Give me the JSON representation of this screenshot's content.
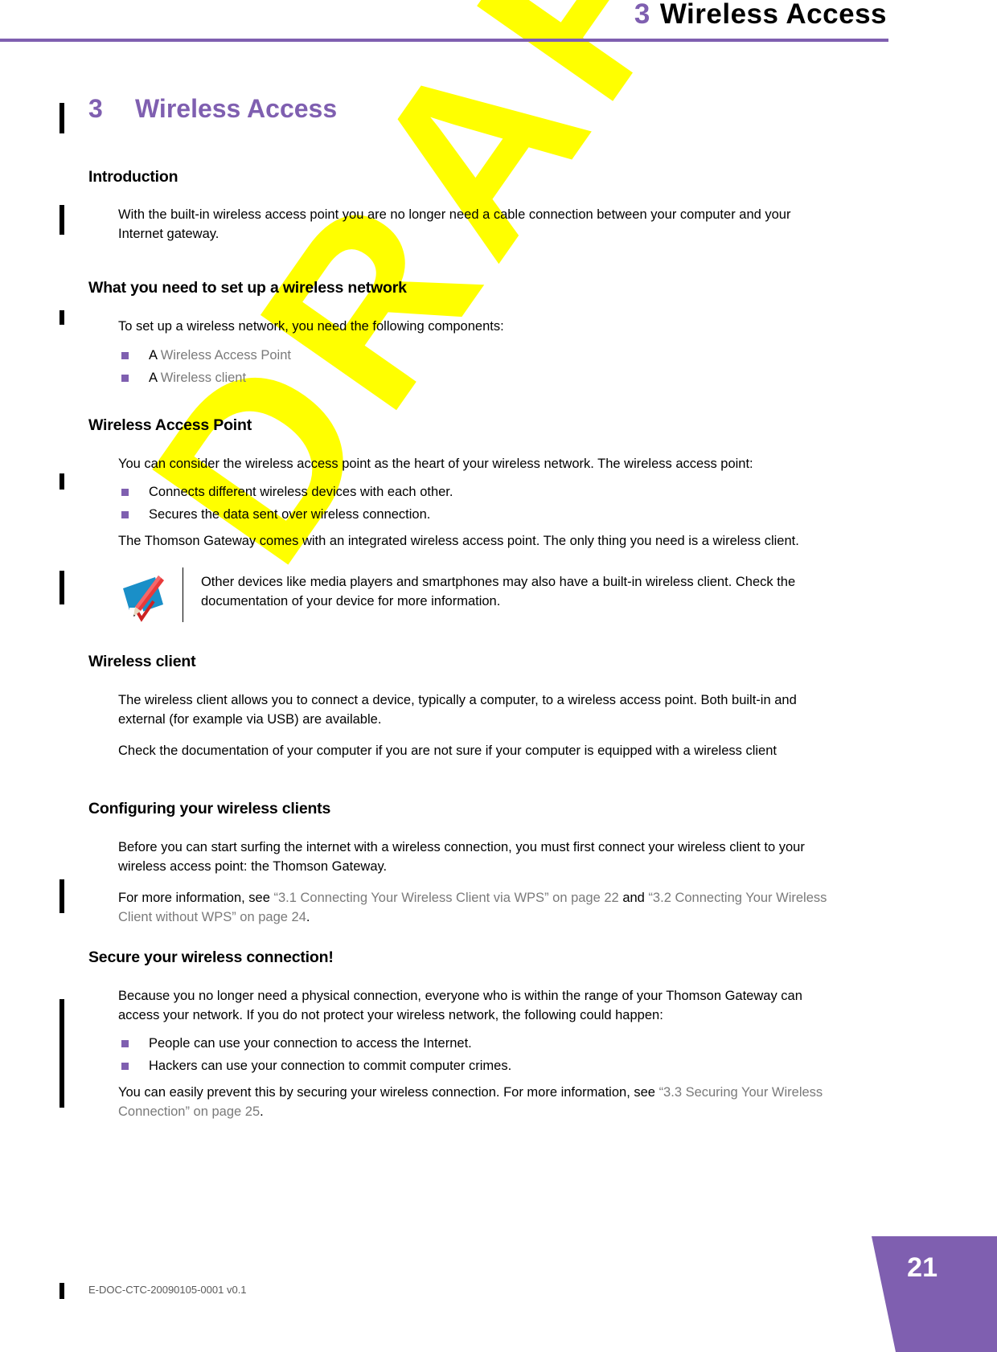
{
  "running_header": {
    "chapter_number": "3",
    "chapter_title": "Wireless Access",
    "rule_color": "#7f5fb0"
  },
  "watermark": {
    "text": "DRAFT",
    "color": "#ffff00"
  },
  "chapter_heading": {
    "number": "3",
    "title": "Wireless Access",
    "color": "#7f5fb0"
  },
  "sections": {
    "introduction": {
      "heading": "Introduction",
      "paragraph": "With the built-in wireless access point you are no longer need a cable connection between your computer and your Internet gateway."
    },
    "what_you_need": {
      "heading": "What you need to set up a wireless network",
      "intro": "To set up a wireless network, you need the following components:",
      "bullets": [
        {
          "prefix": "A ",
          "xref": "Wireless Access Point"
        },
        {
          "prefix": "A ",
          "xref": "Wireless client"
        }
      ]
    },
    "wireless_access_point": {
      "heading": "Wireless Access Point",
      "intro": "You can consider the wireless access point as the heart of your wireless network. The wireless access point:",
      "bullets": [
        "Connects different wireless devices with each other.",
        "Secures the data sent over wireless connection."
      ],
      "outro": "The Thomson Gateway comes with an integrated wireless access point. The only thing you need is a wireless client.",
      "note": {
        "icon": "note-pencil-icon",
        "text": "Other devices like media players and smartphones may also have a built-in wireless client. Check the documentation of your device for more information."
      }
    },
    "wireless_client": {
      "heading": "Wireless client",
      "paragraph_1": "The wireless client allows you to connect a device, typically a computer, to a wireless access point. Both built-in and external (for example via USB) are available.",
      "paragraph_2": "Check the documentation of your computer if you are not sure if your computer is equipped with a wireless client"
    },
    "configuring_clients": {
      "heading": "Configuring your wireless clients",
      "paragraph_1": "Before you can start surfing the internet with a wireless connection, you must first connect your wireless client to your wireless access point: the Thomson Gateway.",
      "xref_sentence": {
        "lead": "For more information, see ",
        "xref_1": "“3.1 Connecting Your Wireless Client via WPS” on page 22",
        "mid": " and ",
        "xref_2": "“3.2 Connecting Your Wireless Client without WPS” on page 24",
        "end": "."
      }
    },
    "secure_connection": {
      "heading": "Secure your wireless connection!",
      "paragraph_1": "Because you no longer need a physical connection, everyone who is within the range of your Thomson Gateway can access your network. If you do not protect your wireless network, the following could happen:",
      "bullets": [
        "People can use your connection to access the Internet.",
        "Hackers can use your connection to commit computer crimes."
      ],
      "xref_sentence": {
        "lead": "You can easily prevent this by securing your wireless connection. For more information, see ",
        "xref_1": "“3.3 Securing Your Wireless Connection” on page 25",
        "end": "."
      }
    }
  },
  "footer": {
    "document_id": "E-DOC-CTC-20090105-0001 v0.1",
    "page_number": "21",
    "page_tab_color": "#7f5fb0"
  }
}
